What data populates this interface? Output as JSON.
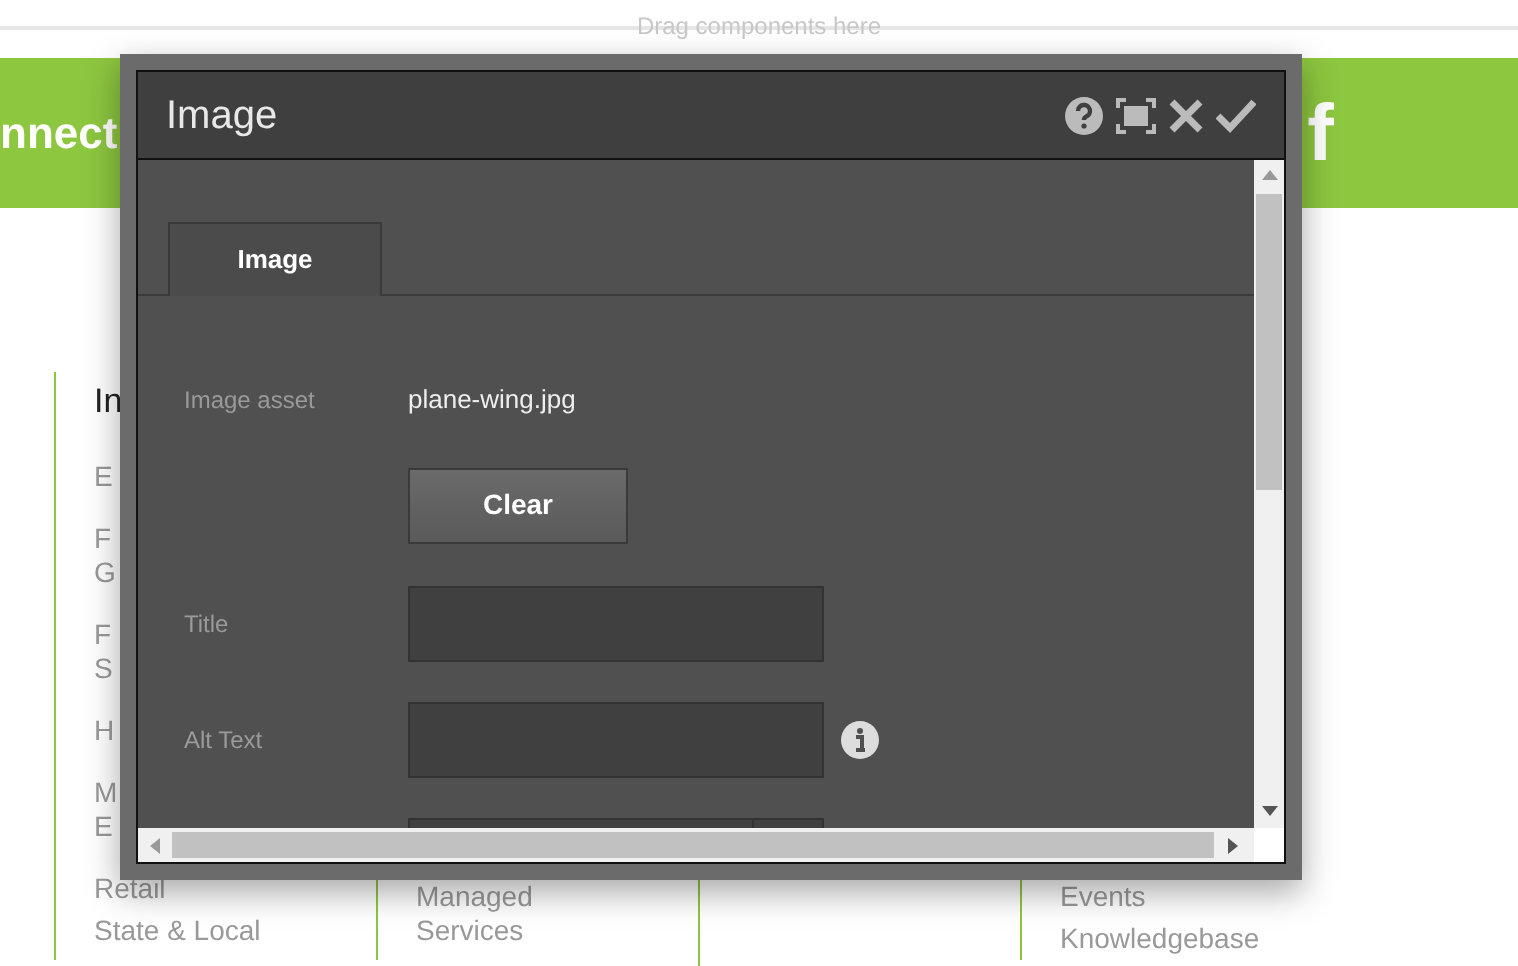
{
  "page": {
    "drop_hint": "Drag components here",
    "banner_text": "nnect",
    "banner_letter": "f",
    "columns": [
      {
        "heading": "In",
        "items": [
          [
            "E"
          ],
          [
            "F",
            "G"
          ],
          [
            "F",
            "S"
          ],
          [
            "H"
          ],
          [
            "M",
            "E"
          ],
          [
            "Retail"
          ],
          [
            "State & Local"
          ]
        ]
      },
      {
        "items": [
          [
            "Managed",
            "Services"
          ]
        ]
      },
      {},
      {
        "items": [
          [
            "Events"
          ],
          [
            "Knowledgebase"
          ]
        ]
      }
    ]
  },
  "dialog": {
    "title": "Image",
    "header_buttons": [
      {
        "kind": "help"
      },
      {
        "kind": "fullscreen"
      },
      {
        "kind": "close"
      },
      {
        "kind": "done"
      }
    ],
    "tabs": [
      {
        "label": "Image",
        "selected": true
      }
    ],
    "fields": [
      {
        "kind": "value",
        "label": "Image asset",
        "value": "plane-wing.jpg"
      },
      {
        "kind": "button",
        "label": "Clear"
      },
      {
        "kind": "input",
        "label": "Title"
      },
      {
        "kind": "input",
        "label": "Alt Text",
        "info": true
      },
      {
        "kind": "select"
      }
    ]
  }
}
